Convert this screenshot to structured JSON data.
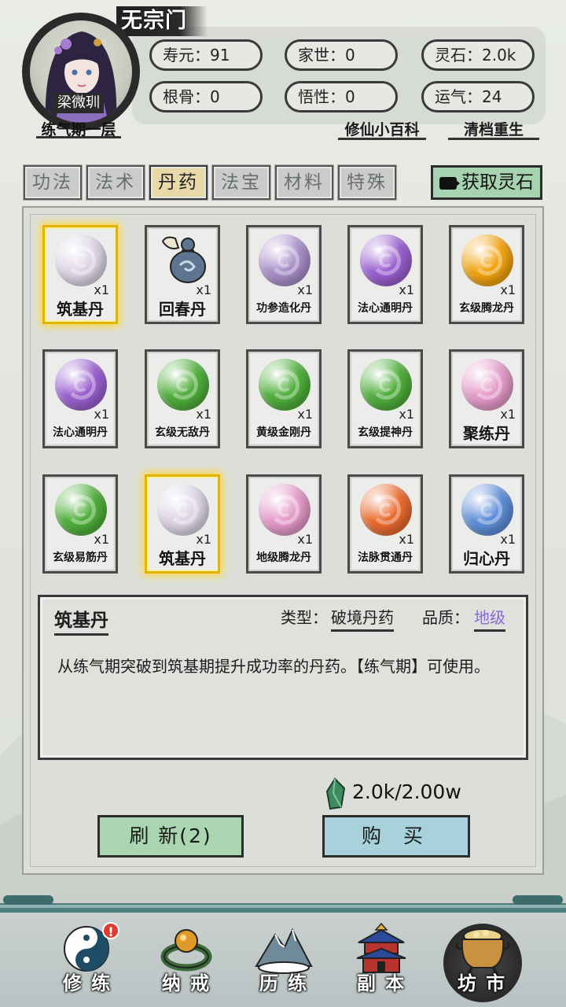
{
  "header": {
    "sect": "无宗门",
    "character_name": "梁微玔",
    "realm": "练气期一层",
    "stats": [
      {
        "label": "寿元：91"
      },
      {
        "label": "家世：0"
      },
      {
        "label": "灵石：2.0k"
      },
      {
        "label": "根骨：0"
      },
      {
        "label": "悟性：0"
      },
      {
        "label": "运气：24"
      }
    ],
    "links": [
      "修仙小百科",
      "清档重生"
    ]
  },
  "tabs": [
    {
      "label": "功法",
      "active": false
    },
    {
      "label": "法术",
      "active": false
    },
    {
      "label": "丹药",
      "active": true
    },
    {
      "label": "法宝",
      "active": false
    },
    {
      "label": "材料",
      "active": false
    },
    {
      "label": "特殊",
      "active": false
    }
  ],
  "get_stone_label": "获取灵石",
  "items": [
    {
      "name": "筑基丹",
      "qty": "x1",
      "color": "#dcd4e4",
      "big": true,
      "selected": true
    },
    {
      "name": "回春丹",
      "qty": "x1",
      "color": "gourd",
      "big": true,
      "selected": false
    },
    {
      "name": "功参造化丹",
      "qty": "x1",
      "color": "#a98fc9",
      "big": false,
      "selected": false
    },
    {
      "name": "法心通明丹",
      "qty": "x1",
      "color": "#9a5fd0",
      "big": false,
      "selected": false
    },
    {
      "name": "玄级腾龙丹",
      "qty": "x1",
      "color": "#f1a210",
      "big": false,
      "selected": false
    },
    {
      "name": "法心通明丹",
      "qty": "x1",
      "color": "#9a5fd0",
      "big": false,
      "selected": false
    },
    {
      "name": "玄级无敌丹",
      "qty": "x1",
      "color": "#4fae3b",
      "big": false,
      "selected": false
    },
    {
      "name": "黄级金刚丹",
      "qty": "x1",
      "color": "#4fae3b",
      "big": false,
      "selected": false
    },
    {
      "name": "玄级提神丹",
      "qty": "x1",
      "color": "#4fae3b",
      "big": false,
      "selected": false
    },
    {
      "name": "聚练丹",
      "qty": "x1",
      "color": "#e49ac9",
      "big": true,
      "selected": false
    },
    {
      "name": "玄级易筋丹",
      "qty": "x1",
      "color": "#4fae3b",
      "big": false,
      "selected": false
    },
    {
      "name": "筑基丹",
      "qty": "x1",
      "color": "#dcd4e4",
      "big": true,
      "selected": true
    },
    {
      "name": "地级腾龙丹",
      "qty": "x1",
      "color": "#e49ac9",
      "big": false,
      "selected": false
    },
    {
      "name": "法脉贯通丹",
      "qty": "x1",
      "color": "#ea6a2e",
      "big": false,
      "selected": false
    },
    {
      "name": "归心丹",
      "qty": "x1",
      "color": "#5e8ed8",
      "big": true,
      "selected": false
    }
  ],
  "detail": {
    "name": "筑基丹",
    "type_label": "类型：",
    "type": "破境丹药",
    "quality_label": "品质：",
    "quality": "地级",
    "description": "从练气期突破到筑基期提升成功率的丹药。【练气期】可使用。"
  },
  "price": "2.0k/2.00w",
  "buttons": {
    "refresh": "刷 新(2)",
    "buy": "购 买"
  },
  "nav": [
    {
      "label": "修 练",
      "icon": "yin-yang-icon",
      "alert": "!",
      "active": false
    },
    {
      "label": "纳 戒",
      "icon": "ring-icon",
      "active": false
    },
    {
      "label": "历 练",
      "icon": "mountain-icon",
      "active": false
    },
    {
      "label": "副 本",
      "icon": "pagoda-icon",
      "active": false
    },
    {
      "label": "坊 市",
      "icon": "cauldron-icon",
      "active": true
    }
  ]
}
